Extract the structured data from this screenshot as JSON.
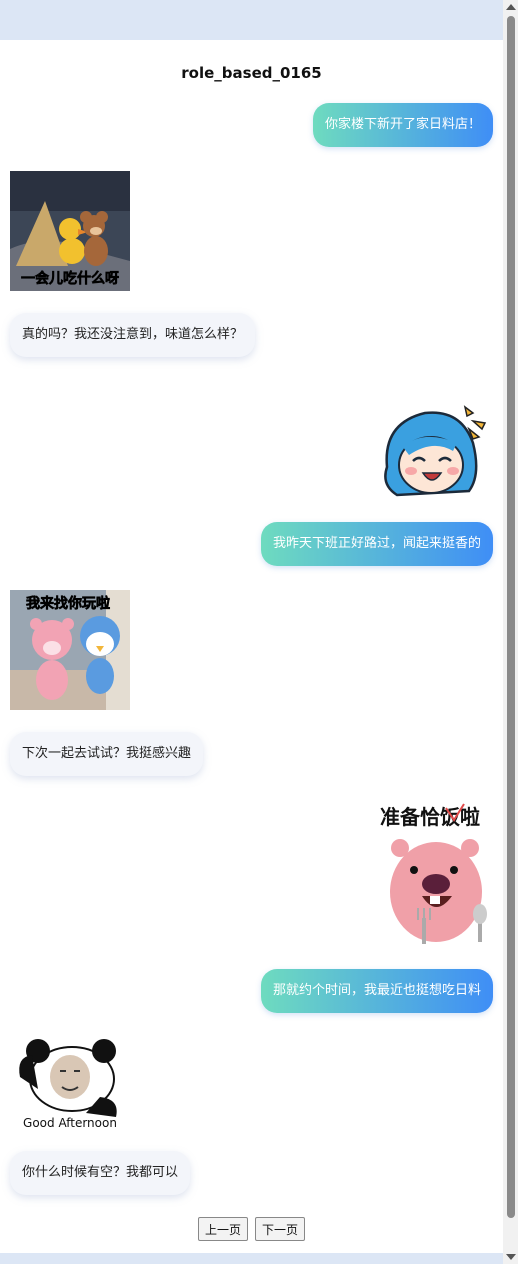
{
  "title": "role_based_0165",
  "messages": [
    {
      "side": "right",
      "type": "text",
      "text": "你家楼下新开了家日料店！"
    },
    {
      "side": "left",
      "type": "sticker",
      "sticker": "tom-jerry-sticker",
      "caption": "一会儿吃什么呀"
    },
    {
      "side": "left",
      "type": "text",
      "text": "真的吗？我还没注意到，味道怎么样？"
    },
    {
      "side": "right",
      "type": "sticker",
      "sticker": "anime-girl-sticker"
    },
    {
      "side": "right",
      "type": "text",
      "text": "我昨天下班正好路过，闻起来挺香的"
    },
    {
      "side": "left",
      "type": "sticker",
      "sticker": "loopy-pororo-sticker",
      "caption": "我来找你玩啦"
    },
    {
      "side": "left",
      "type": "text",
      "text": "下次一起去试试？我挺感兴趣"
    },
    {
      "side": "right",
      "type": "sticker",
      "sticker": "loopy-eating-sticker",
      "caption": "准备恰饭啦"
    },
    {
      "side": "right",
      "type": "text",
      "text": "那就约个时间，我最近也挺想吃日料"
    },
    {
      "side": "left",
      "type": "sticker",
      "sticker": "panda-meme-sticker",
      "caption": "Good Afternoon"
    },
    {
      "side": "left",
      "type": "text",
      "text": "你什么时候有空？我都可以"
    }
  ],
  "pager": {
    "prev_label": "上一页",
    "next_label": "下一页"
  }
}
